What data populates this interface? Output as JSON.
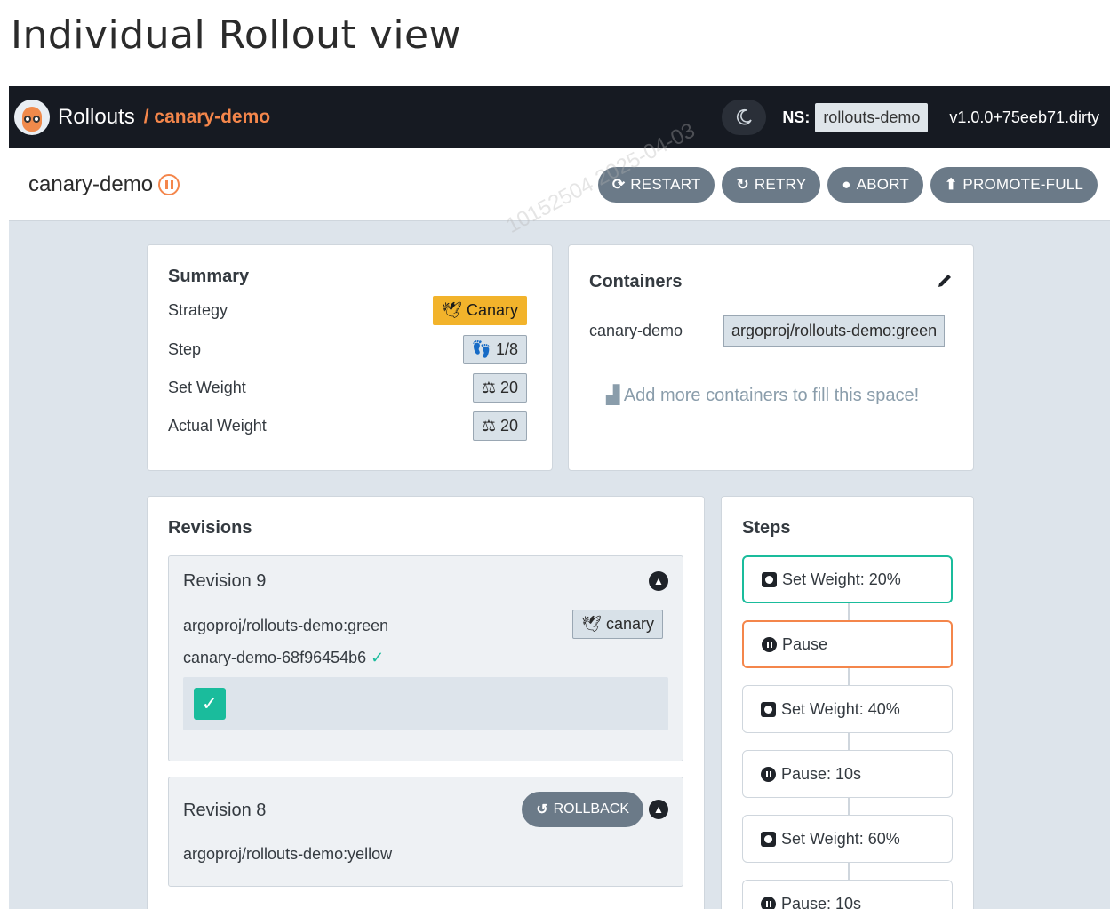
{
  "page_title": "Individual Rollout view",
  "topbar": {
    "brand": "Rollouts",
    "path": "/ canary-demo",
    "ns_label": "NS:",
    "namespace": "rollouts-demo",
    "version": "v1.0.0+75eeb71.dirty",
    "theme_icon": "moon-icon"
  },
  "header": {
    "rollout_name": "canary-demo",
    "status_icon": "pause-circle-icon",
    "actions": {
      "restart": "RESTART",
      "retry": "RETRY",
      "abort": "ABORT",
      "promote_full": "PROMOTE-FULL"
    }
  },
  "watermark": "10152504  2025-04-03",
  "summary": {
    "title": "Summary",
    "strategy_label": "Strategy",
    "strategy_value": "Canary",
    "step_label": "Step",
    "step_value": "1/8",
    "set_weight_label": "Set Weight",
    "set_weight_value": "20",
    "actual_weight_label": "Actual Weight",
    "actual_weight_value": "20"
  },
  "containers": {
    "title": "Containers",
    "edit_icon": "pencil-icon",
    "name": "canary-demo",
    "image": "argoproj/rollouts-demo:green",
    "hint": "Add more containers to fill this space!"
  },
  "revisions": {
    "title": "Revisions",
    "items": [
      {
        "title": "Revision 9",
        "image": "argoproj/rollouts-demo:green",
        "tag": "canary",
        "replicaset": "canary-demo-68f96454b6"
      },
      {
        "title": "Revision 8",
        "rollback": "ROLLBACK",
        "image": "argoproj/rollouts-demo:yellow"
      }
    ]
  },
  "steps": {
    "title": "Steps",
    "items": [
      "Set Weight: 20%",
      "Pause",
      "Set Weight: 40%",
      "Pause: 10s",
      "Set Weight: 60%",
      "Pause: 10s"
    ]
  },
  "colors": {
    "topbar_bg": "#161a22",
    "accent_orange": "#f4864b",
    "canary_yellow": "#f2b32b",
    "success_green": "#1abc9c",
    "button_gray": "#6b7a88"
  }
}
